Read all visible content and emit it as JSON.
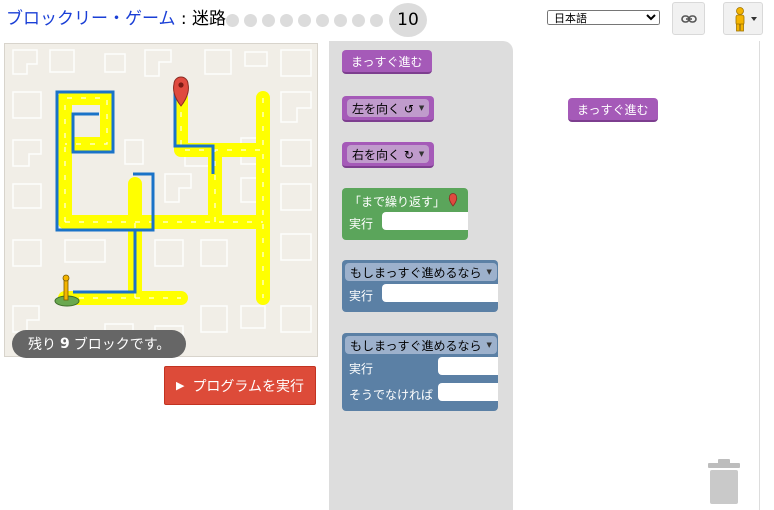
{
  "header": {
    "title_link": "ブロックリー・ゲーム",
    "title_sep": " : ",
    "title_app": "迷路",
    "levels": [
      1,
      2,
      3,
      4,
      5,
      6,
      7,
      8,
      9
    ],
    "current_level": "10",
    "language": "日本語",
    "language_options": [
      "日本語"
    ]
  },
  "maze": {
    "blocks_remaining_prefix": "残り",
    "blocks_remaining_count": "9",
    "blocks_remaining_suffix": "ブロックです。",
    "colors": {
      "path": "#ffff00",
      "route": "#1a73c8",
      "ground": "#f1eee7",
      "marker": "#e04a3f"
    }
  },
  "run_button": {
    "label": "プログラムを実行",
    "color": "#dd4b39"
  },
  "toolbox": {
    "move_forward": "まっすぐ進む",
    "turn_left": "左を向く ↺",
    "turn_right": "右を向く ↻",
    "repeat_until": "「まで繰り返す」",
    "do": "実行",
    "if_path": "もしまっすぐ進めるなら",
    "else": "そうでなければ",
    "colors": {
      "movement": "#a55ab8",
      "loop": "#5ba55b",
      "logic": "#5b80a5"
    }
  },
  "workspace": {
    "blocks": [
      {
        "label": "まっすぐ進む"
      }
    ]
  },
  "icons": {
    "link": "link-icon",
    "pegman": "pegman-icon",
    "trash": "trash-icon",
    "finish": "finish-marker-icon",
    "start": "pegman-start-icon"
  }
}
